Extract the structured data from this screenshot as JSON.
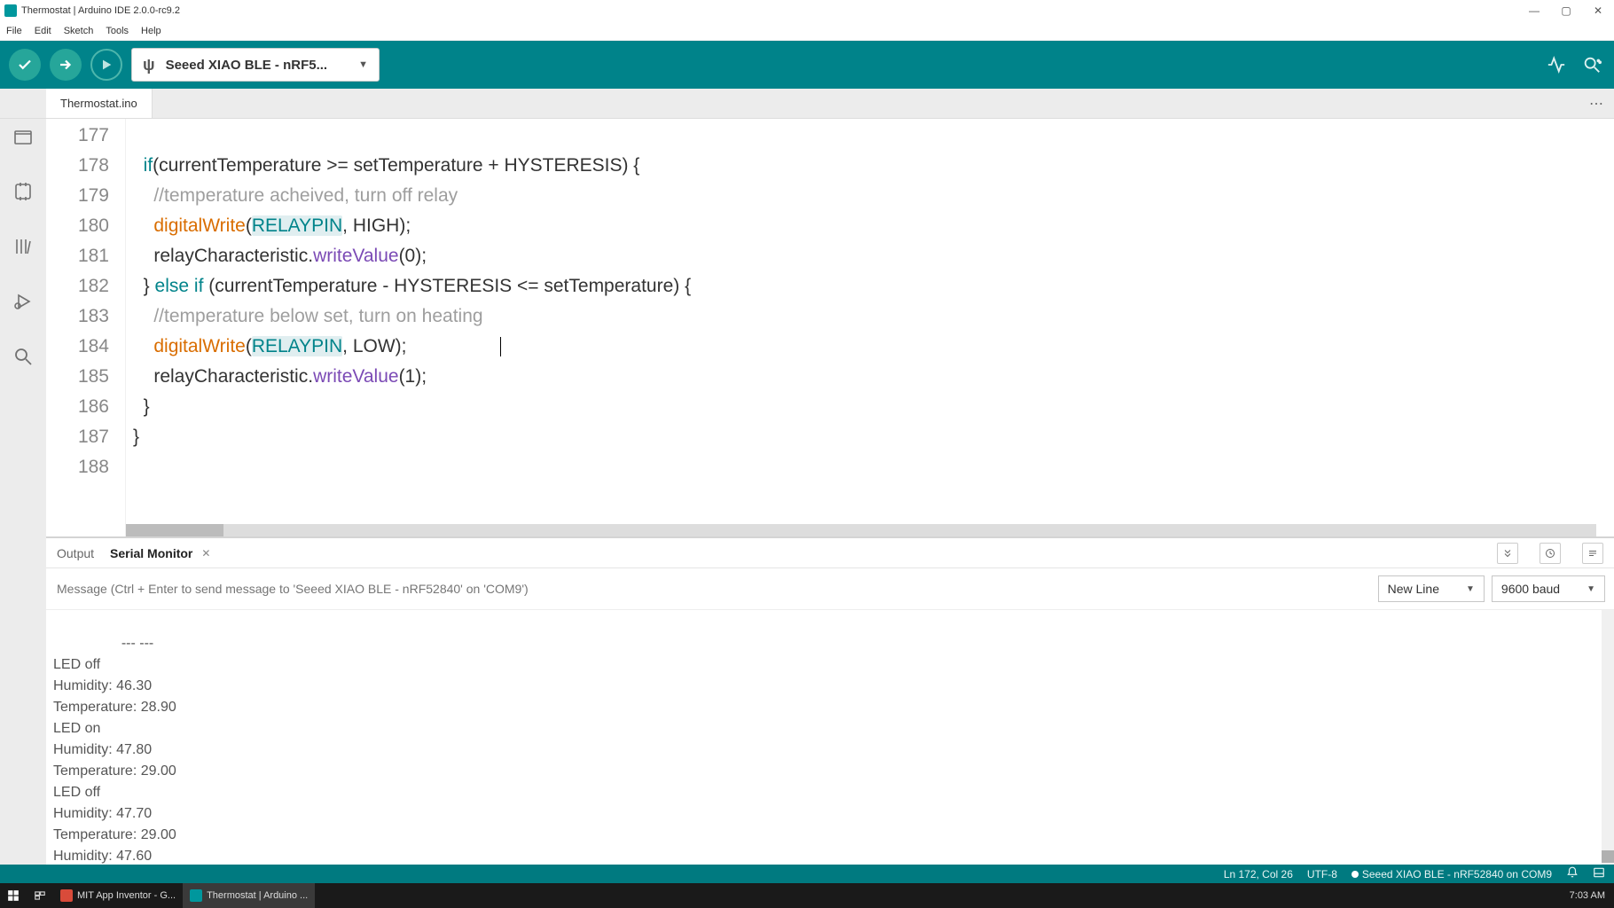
{
  "window": {
    "title": "Thermostat | Arduino IDE 2.0.0-rc9.2"
  },
  "menubar": [
    "File",
    "Edit",
    "Sketch",
    "Tools",
    "Help"
  ],
  "board_selector": "Seeed XIAO BLE - nRF5...",
  "file_tab": "Thermostat.ino",
  "code_lines": [
    {
      "n": 177,
      "html": ""
    },
    {
      "n": 178,
      "html": "  <span class='tok-keyword'>if</span>(currentTemperature &gt;= setTemperature + HYSTERESIS) {"
    },
    {
      "n": 179,
      "html": "    <span class='tok-comment'>//temperature acheived, turn off relay</span>"
    },
    {
      "n": 180,
      "html": "    <span class='tok-func'>digitalWrite</span>(<span class='tok-const tok-hl'>RELAYPIN</span>, HIGH);"
    },
    {
      "n": 181,
      "html": "    relayCharacteristic.<span class='tok-method'>writeValue</span>(0);"
    },
    {
      "n": 182,
      "html": "  } <span class='tok-keyword'>else</span> <span class='tok-keyword'>if</span> (currentTemperature - HYSTERESIS &lt;= setTemperature) {"
    },
    {
      "n": 183,
      "html": "    <span class='tok-comment'>//temperature below set, turn on heating</span>"
    },
    {
      "n": 184,
      "html": "    <span class='tok-func'>digitalWrite</span>(<span class='tok-const tok-hl'>RELAYPIN</span>, LOW);",
      "cursor_after": true
    },
    {
      "n": 185,
      "html": "    relayCharacteristic.<span class='tok-method'>writeValue</span>(1);"
    },
    {
      "n": 186,
      "html": "  }"
    },
    {
      "n": 187,
      "html": "}"
    },
    {
      "n": 188,
      "html": ""
    }
  ],
  "panel_tabs": {
    "output": "Output",
    "serial": "Serial Monitor"
  },
  "serial_input_placeholder": "Message (Ctrl + Enter to send message to 'Seeed XIAO BLE - nRF52840' on 'COM9')",
  "line_ending": "New Line",
  "baud": "9600 baud",
  "serial_output": "--- ---\nLED off\nHumidity: 46.30\nTemperature: 28.90\nLED on\nHumidity: 47.80\nTemperature: 29.00\nLED off\nHumidity: 47.70\nTemperature: 29.00\nHumidity: 47.60",
  "statusbar": {
    "pos": "Ln 172, Col 26",
    "encoding": "UTF-8",
    "board": "Seeed XIAO BLE - nRF52840 on COM9"
  },
  "taskbar": {
    "items": [
      {
        "label": "MIT App Inventor - G..."
      },
      {
        "label": "Thermostat | Arduino ..."
      }
    ],
    "clock": "7:03 AM"
  }
}
